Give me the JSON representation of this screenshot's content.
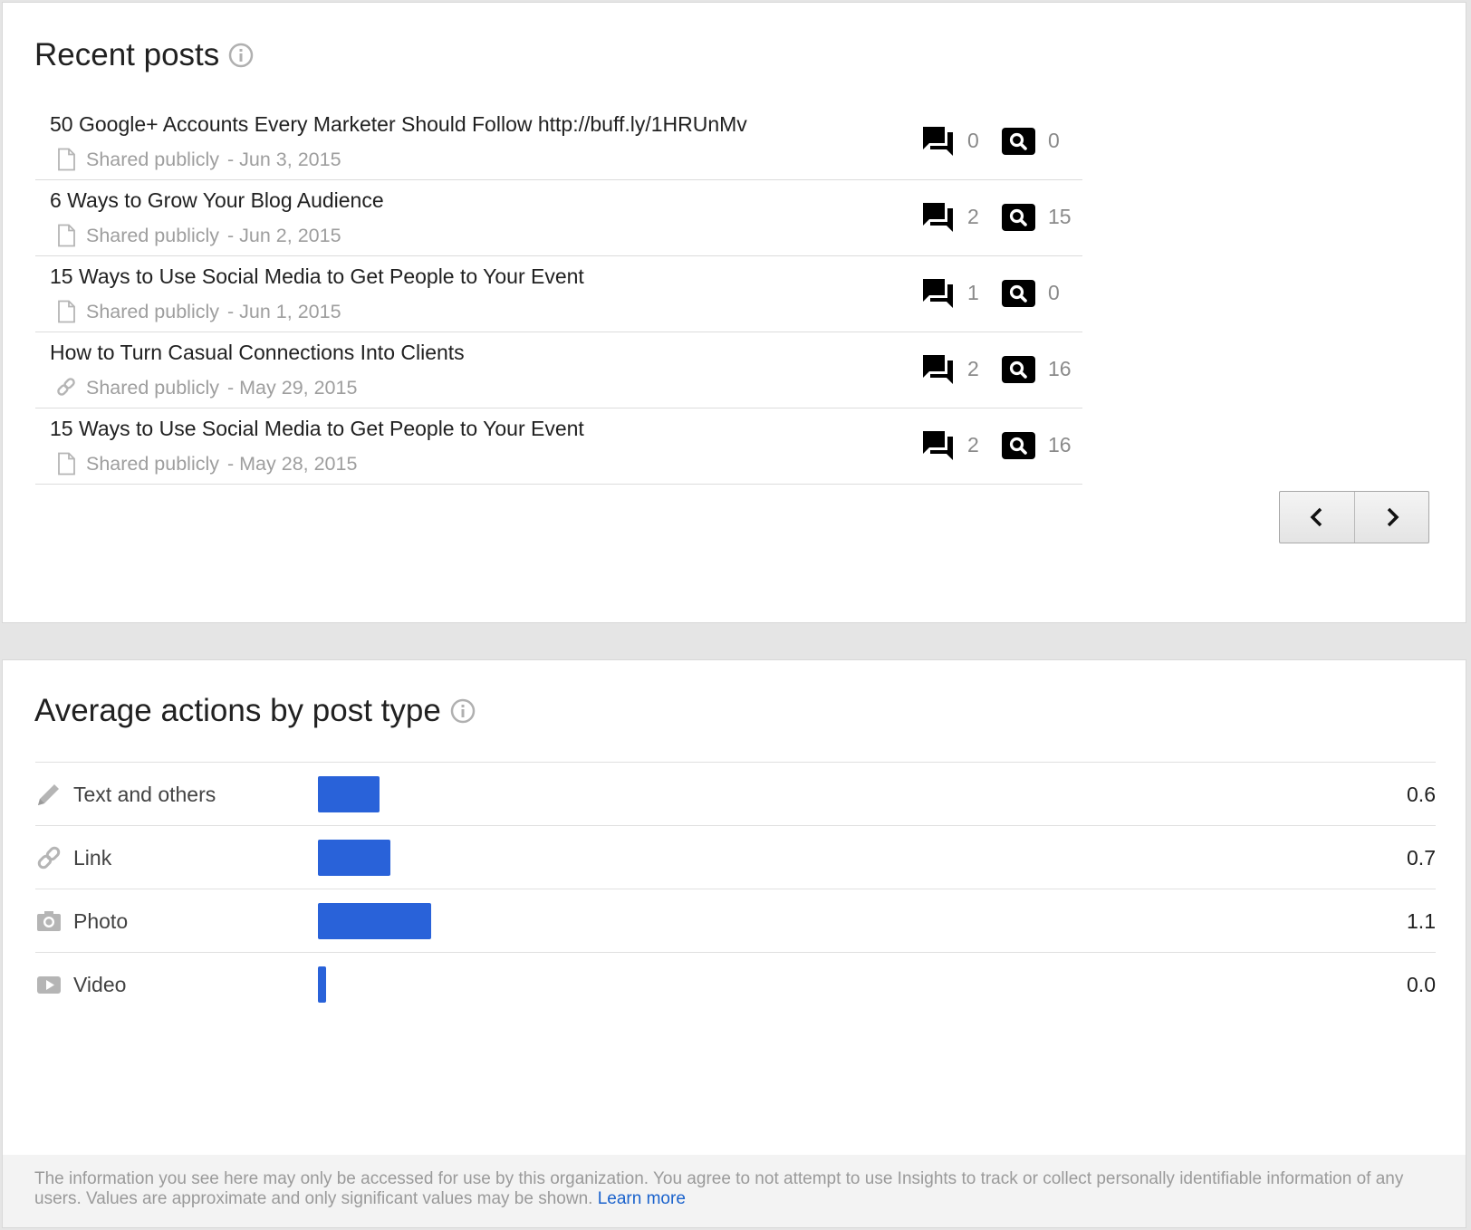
{
  "recent_posts": {
    "title": "Recent posts",
    "posts": [
      {
        "title": "50 Google+ Accounts Every Marketer Should Follow http://buff.ly/1HRUnMv",
        "visibility": "Shared publicly",
        "date": "- Jun 3, 2015",
        "type_icon": "document-icon",
        "comments": "0",
        "views": "0"
      },
      {
        "title": "6 Ways to Grow Your Blog Audience",
        "visibility": "Shared publicly",
        "date": "- Jun 2, 2015",
        "type_icon": "document-icon",
        "comments": "2",
        "views": "15"
      },
      {
        "title": "15 Ways to Use Social Media to Get People to Your Event",
        "visibility": "Shared publicly",
        "date": "- Jun 1, 2015",
        "type_icon": "document-icon",
        "comments": "1",
        "views": "0"
      },
      {
        "title": "How to Turn Casual Connections Into Clients",
        "visibility": "Shared publicly",
        "date": "- May 29, 2015",
        "type_icon": "link-icon",
        "comments": "2",
        "views": "16"
      },
      {
        "title": "15 Ways to Use Social Media to Get People to Your Event",
        "visibility": "Shared publicly",
        "date": "- May 28, 2015",
        "type_icon": "document-icon",
        "comments": "2",
        "views": "16"
      }
    ]
  },
  "average_actions": {
    "title": "Average actions by post type",
    "rows": [
      {
        "label": "Text and others",
        "value": "0.6",
        "icon": "pencil-icon"
      },
      {
        "label": "Link",
        "value": "0.7",
        "icon": "link-icon"
      },
      {
        "label": "Photo",
        "value": "1.1",
        "icon": "camera-icon"
      },
      {
        "label": "Video",
        "value": "0.0",
        "icon": "video-icon"
      }
    ]
  },
  "chart_data": {
    "type": "bar",
    "categories": [
      "Text and others",
      "Link",
      "Photo",
      "Video"
    ],
    "values": [
      0.6,
      0.7,
      1.1,
      0.0
    ],
    "title": "Average actions by post type",
    "bar_color": "#2962d9"
  },
  "footer": {
    "text": "The information you see here may only be accessed for use by this organization. You agree to not attempt to use Insights to track or collect personally identifiable information of any users. Values are approximate and only significant values may be shown.",
    "link_label": "Learn more"
  },
  "colors": {
    "accent": "#2962d9",
    "link": "#1a62cc"
  }
}
